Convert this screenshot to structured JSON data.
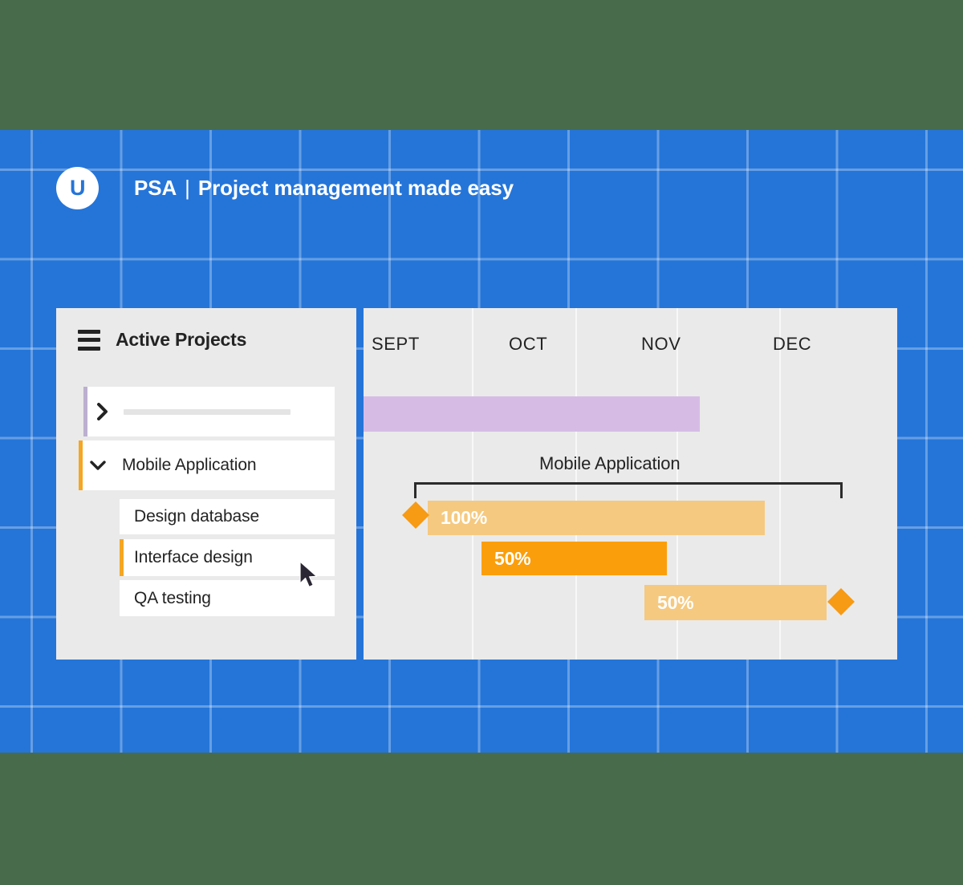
{
  "header": {
    "logo_glyph": "U",
    "brand": "PSA",
    "separator": "|",
    "tagline": "Project management made easy"
  },
  "sidebar": {
    "title": "Active Projects",
    "menu_icon": "hamburger-icon",
    "items": [
      {
        "label": "",
        "placeholder": true,
        "accent": "#BCAFD0",
        "expanded": false,
        "chevron": "chevron-right-icon",
        "level": 0
      },
      {
        "label": "Mobile Application",
        "placeholder": false,
        "accent": "#F5A623",
        "expanded": true,
        "chevron": "chevron-down-icon",
        "level": 0
      },
      {
        "label": "Design database",
        "placeholder": false,
        "accent": "",
        "expanded": false,
        "chevron": "",
        "level": 1
      },
      {
        "label": "Interface design",
        "placeholder": false,
        "accent": "#F5A623",
        "expanded": false,
        "chevron": "",
        "level": 1
      },
      {
        "label": "QA testing",
        "placeholder": false,
        "accent": "",
        "expanded": false,
        "chevron": "",
        "level": 1
      }
    ]
  },
  "gantt": {
    "months": [
      "SEPT",
      "OCT",
      "NOV",
      "DEC"
    ],
    "group_label": "Mobile Application",
    "summary_bar_color": "#D6BCE5",
    "bars": [
      {
        "percent": "100%",
        "color": "#F5C97F"
      },
      {
        "percent": "50%",
        "color": "#FB9E0B"
      },
      {
        "percent": "50%",
        "color": "#F5C97F"
      }
    ],
    "milestones": [
      "milestone-start-diamond",
      "milestone-end-diamond"
    ]
  },
  "colors": {
    "brand_blue": "#2575D9",
    "band_green": "#486B4B",
    "panel_gray": "#EAEAEA",
    "accent_orange": "#F5A623",
    "accent_purple": "#BCAFD0",
    "bar_light": "#F5C97F",
    "bar_bright": "#FB9E0B",
    "summary_purple": "#D6BCE5"
  },
  "cursor": {
    "icon": "arrow-cursor"
  }
}
